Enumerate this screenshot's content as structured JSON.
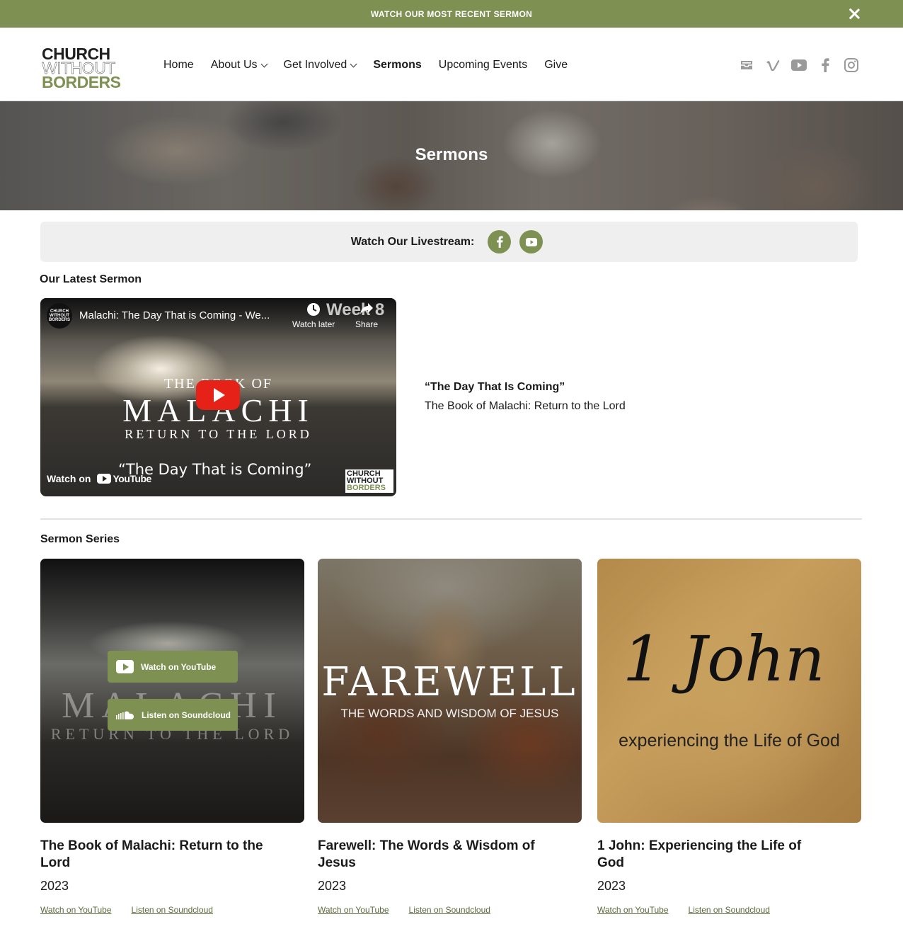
{
  "announcement": {
    "text": "WATCH OUR MOST RECENT SERMON"
  },
  "logo": {
    "line1": "CHURCH",
    "line2": "WITHOUT",
    "line3": "BORDERS"
  },
  "nav": {
    "home": "Home",
    "about": "About Us",
    "get_involved": "Get Involved",
    "sermons": "Sermons",
    "events": "Upcoming Events",
    "give": "Give"
  },
  "social_icons": [
    "inbox-icon",
    "vimeo-icon",
    "youtube-icon",
    "facebook-icon",
    "instagram-icon"
  ],
  "hero": {
    "title": "Sermons"
  },
  "livestream": {
    "label": "Watch Our Livestream:"
  },
  "latest": {
    "heading": "Our Latest Sermon",
    "video": {
      "title": "Malachi: The Day That is Coming - We...",
      "channel_line1": "CHURCH",
      "channel_line2": "WITHOUT",
      "channel_line3": "BORDERS",
      "watch_later": "Watch later",
      "share": "Share",
      "week_text": "Week 8",
      "book_the": "THE BOOK OF",
      "book_name": "MALACHI",
      "book_sub": "RETURN TO THE LORD",
      "subtitle": "“The Day That is Coming”",
      "watch_on": "Watch on",
      "youtube": "YouTube"
    },
    "quote": "“The Day That Is Coming”",
    "series": "The Book of Malachi: Return to the Lord"
  },
  "series_heading": "Sermon Series",
  "cards": [
    {
      "title": "The Book of Malachi: Return to the Lord",
      "year": "2023",
      "watch": "Watch on YouTube",
      "listen": "Listen on Soundcloud",
      "art_line1": "MALACHI",
      "art_line2": "RETURN TO THE LORD",
      "overlay_watch": "Watch on YouTube",
      "overlay_listen": "Listen on Soundcloud"
    },
    {
      "title": "Farewell: The Words & Wisdom of Jesus",
      "year": "2023",
      "watch": "Watch on YouTube",
      "listen": "Listen on Soundcloud",
      "art_line1": "FAREWELL",
      "art_line2": "THE WORDS AND WISDOM OF JESUS"
    },
    {
      "title": "1 John: Experiencing the Life of God",
      "year": "2023",
      "watch": "Watch on YouTube",
      "listen": "Listen on Soundcloud",
      "art_line1": "1 John",
      "art_line2": "experiencing the Life of God"
    }
  ],
  "colors": {
    "accent": "#7e9153",
    "link": "#5a6b39"
  }
}
